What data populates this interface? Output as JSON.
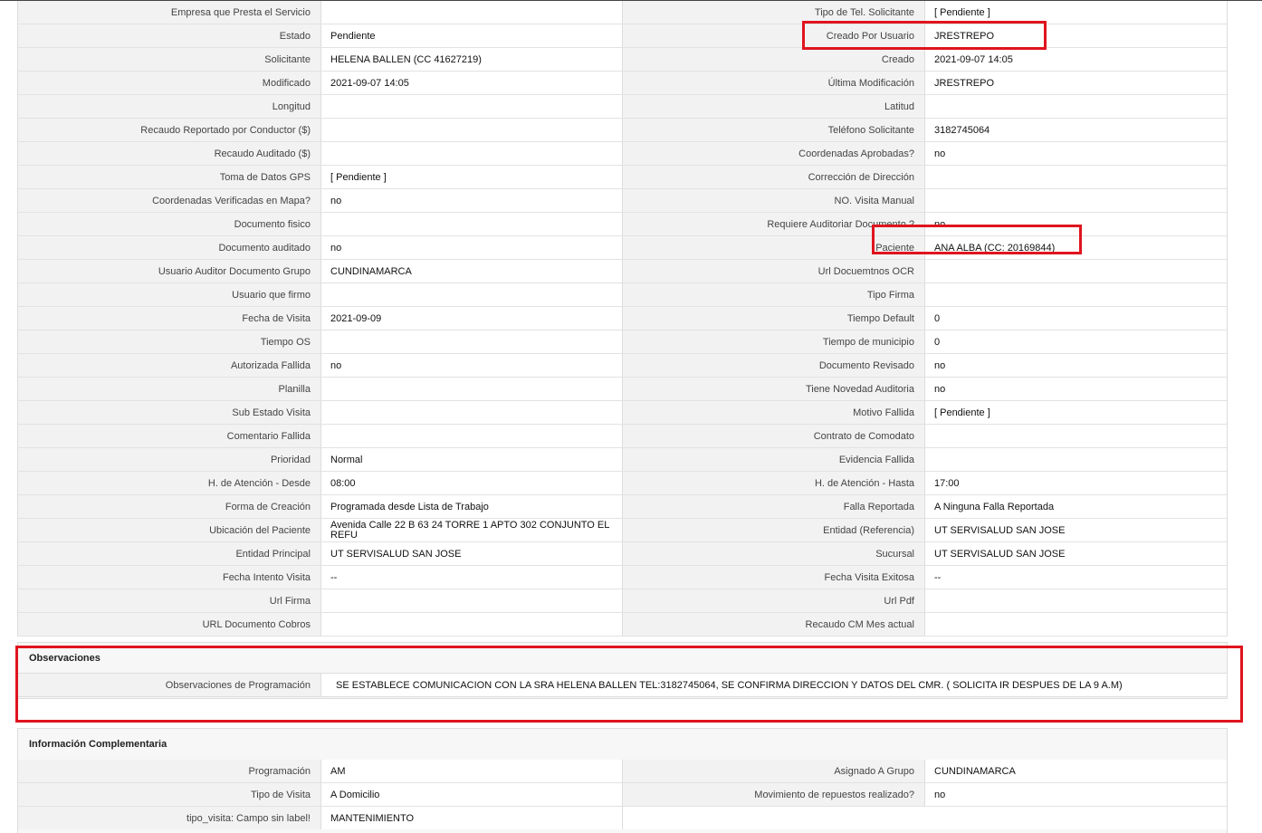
{
  "main_rows": [
    {
      "l1": "Empresa que Presta el Servicio",
      "v1": "",
      "l2": "Tipo de Tel. Solicitante",
      "v2": "[ Pendiente ]"
    },
    {
      "l1": "Estado",
      "v1": "Pendiente",
      "l2": "Creado Por Usuario",
      "v2": "JRESTREPO"
    },
    {
      "l1": "Solicitante",
      "v1": "HELENA BALLEN (CC 41627219)",
      "l2": "Creado",
      "v2": "2021-09-07 14:05"
    },
    {
      "l1": "Modificado",
      "v1": "2021-09-07 14:05",
      "l2": "Última Modificación",
      "v2": " JRESTREPO"
    },
    {
      "l1": "Longitud",
      "v1": "",
      "l2": "Latitud",
      "v2": ""
    },
    {
      "l1": "Recaudo Reportado por Conductor ($)",
      "v1": "",
      "l2": "Teléfono Solicitante",
      "v2": "3182745064"
    },
    {
      "l1": "Recaudo Auditado ($)",
      "v1": "",
      "l2": "Coordenadas Aprobadas?",
      "v2": " no"
    },
    {
      "l1": "Toma de Datos GPS",
      "v1": "[ Pendiente ]",
      "l2": "Corrección de Dirección",
      "v2": ""
    },
    {
      "l1": "Coordenadas Verificadas en Mapa?",
      "v1": " no",
      "l2": "NO. Visita Manual",
      "v2": ""
    },
    {
      "l1": "Documento fisico",
      "v1": "",
      "l2": "Requiere Auditoriar Documento ?",
      "v2": " no"
    },
    {
      "l1": "Documento auditado",
      "v1": " no",
      "l2": "Paciente",
      "v2": "ANA ALBA (CC: 20169844)"
    },
    {
      "l1": "Usuario Auditor Documento Grupo",
      "v1": "CUNDINAMARCA",
      "l2": "Url Docuemtnos OCR",
      "v2": ""
    },
    {
      "l1": "Usuario que firmo",
      "v1": "",
      "l2": "Tipo Firma",
      "v2": ""
    },
    {
      "l1": "Fecha de Visita",
      "v1": " 2021-09-09",
      "l2": "Tiempo Default",
      "v2": "0"
    },
    {
      "l1": "Tiempo OS",
      "v1": "",
      "l2": "Tiempo de municipio",
      "v2": "0"
    },
    {
      "l1": "Autorizada Fallida",
      "v1": " no",
      "l2": "Documento Revisado",
      "v2": " no"
    },
    {
      "l1": "Planilla",
      "v1": "",
      "l2": "Tiene Novedad Auditoria",
      "v2": " no"
    },
    {
      "l1": "Sub Estado Visita",
      "v1": "",
      "l2": "Motivo Fallida",
      "v2": "[ Pendiente ]"
    },
    {
      "l1": "Comentario Fallida",
      "v1": "",
      "l2": "Contrato de Comodato",
      "v2": ""
    },
    {
      "l1": "Prioridad",
      "v1": "Normal",
      "l2": "Evidencia Fallida",
      "v2": ""
    },
    {
      "l1": "H. de Atención - Desde",
      "v1": "08:00",
      "l2": "H. de Atención - Hasta",
      "v2": "17:00"
    },
    {
      "l1": "Forma de Creación",
      "v1": "Programada desde Lista de Trabajo",
      "l2": "Falla Reportada",
      "v2": "A Ninguna Falla Reportada"
    },
    {
      "l1": "Ubicación del Paciente",
      "v1": "Avenida Calle 22 B 63 24 TORRE 1 APTO 302 CONJUNTO EL REFU",
      "l2": "Entidad (Referencia)",
      "v2": "UT SERVISALUD SAN JOSE"
    },
    {
      "l1": "Entidad Principal",
      "v1": "UT SERVISALUD SAN JOSE",
      "l2": "Sucursal",
      "v2": "UT SERVISALUD SAN JOSE"
    },
    {
      "l1": "Fecha Intento Visita",
      "v1": " --",
      "l2": "Fecha Visita Exitosa",
      "v2": " --"
    },
    {
      "l1": "Url Firma",
      "v1": "",
      "l2": "Url Pdf",
      "v2": ""
    },
    {
      "l1": "URL Documento Cobros",
      "v1": "",
      "l2": "Recaudo CM Mes actual",
      "v2": ""
    }
  ],
  "observaciones": {
    "title": "Observaciones",
    "label": "Observaciones de Programación",
    "value": "SE ESTABLECE COMUNICACION CON LA SRA HELENA BALLEN TEL:3182745064, SE CONFIRMA DIRECCION Y DATOS DEL CMR. ( SOLICITA IR DESPUES DE LA 9 A.M)"
  },
  "complementaria": {
    "title": "Información Complementaria",
    "rows": [
      {
        "l1": "Programación",
        "v1": "AM",
        "l2": "Asignado A Grupo",
        "v2": "CUNDINAMARCA"
      },
      {
        "l1": "Tipo de Visita",
        "v1": "A Domicilio",
        "l2": "Movimiento de repuestos realizado?",
        "v2": " no"
      },
      {
        "l1": "tipo_visita: Campo sin label!",
        "v1": "MANTENIMIENTO"
      }
    ]
  },
  "highlight_color": "#e0141e"
}
